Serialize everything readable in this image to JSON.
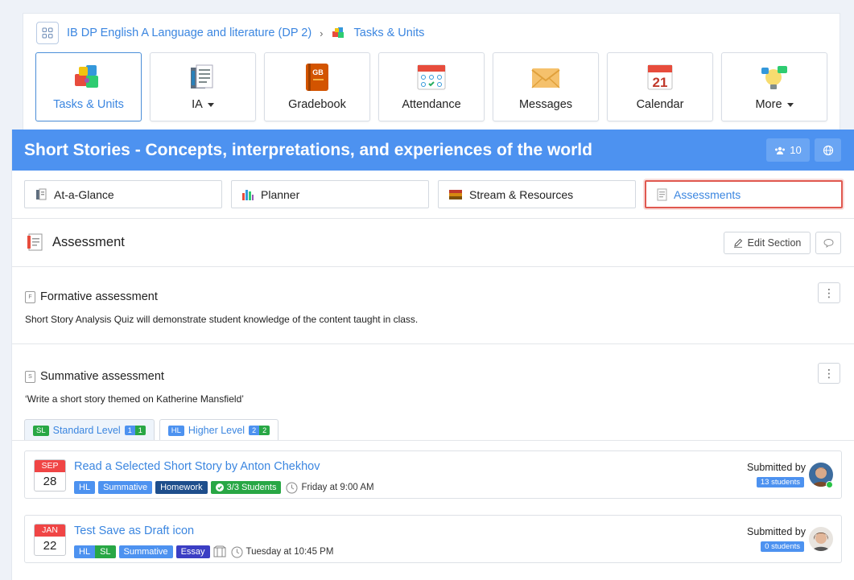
{
  "breadcrumb": {
    "course": "IB DP English A Language and literature (DP 2)",
    "current": "Tasks & Units"
  },
  "nav": [
    {
      "label": "Tasks & Units",
      "icon": "puzzle-icon",
      "active": true,
      "dropdown": false
    },
    {
      "label": "IA",
      "icon": "documents-icon",
      "active": false,
      "dropdown": true
    },
    {
      "label": "Gradebook",
      "icon": "gradebook-icon",
      "active": false,
      "dropdown": false
    },
    {
      "label": "Attendance",
      "icon": "attendance-icon",
      "active": false,
      "dropdown": false
    },
    {
      "label": "Messages",
      "icon": "envelope-icon",
      "active": false,
      "dropdown": false
    },
    {
      "label": "Calendar",
      "icon": "calendar-icon",
      "active": false,
      "dropdown": false
    },
    {
      "label": "More",
      "icon": "lightbulb-icon",
      "active": false,
      "dropdown": true
    }
  ],
  "gradebook_icon_text": "GB",
  "calendar_icon_day": "21",
  "unit": {
    "title": "Short Stories - Concepts, interpretations, and experiences of the world",
    "member_count": "10"
  },
  "subtabs": [
    {
      "label": "At-a-Glance",
      "active": false
    },
    {
      "label": "Planner",
      "active": false
    },
    {
      "label": "Stream & Resources",
      "active": false
    },
    {
      "label": "Assessments",
      "active": true
    }
  ],
  "section": {
    "title": "Assessment",
    "edit_label": "Edit Section"
  },
  "formative": {
    "icon_letter": "F",
    "title": "Formative assessment",
    "description": "Short Story Analysis Quiz will demonstrate student knowledge of the content taught in class."
  },
  "summative": {
    "icon_letter": "S",
    "title": "Summative assessment",
    "description": "‘Write a short story themed on Katherine Mansfield’"
  },
  "level_tabs": [
    {
      "badge": "SL",
      "label": "Standard Level",
      "count_a": "1",
      "count_b": "1"
    },
    {
      "badge": "HL",
      "label": "Higher Level",
      "count_a": "2",
      "count_b": "2"
    }
  ],
  "tasks": [
    {
      "month": "SEP",
      "day": "28",
      "title": "Read a Selected Short Story by Anton Chekhov",
      "tags": {
        "level": "HL",
        "type": "Summative",
        "category": "Homework",
        "students": "3/3 Students"
      },
      "due": "Friday at 9:00 AM",
      "submitted_label": "Submitted by",
      "submitted_count": "13 students"
    },
    {
      "month": "JAN",
      "day": "22",
      "title": "Test Save as Draft icon",
      "tags": {
        "level_a": "HL",
        "level_b": "SL",
        "type": "Summative",
        "category": "Essay"
      },
      "due": "Tuesday at 10:45 PM",
      "submitted_label": "Submitted by",
      "submitted_count": "0 students"
    }
  ],
  "colors": {
    "primary": "#4d92f0",
    "link": "#3b86e0",
    "success": "#28a745",
    "danger": "#f04545",
    "highlight": "#e0584f"
  }
}
